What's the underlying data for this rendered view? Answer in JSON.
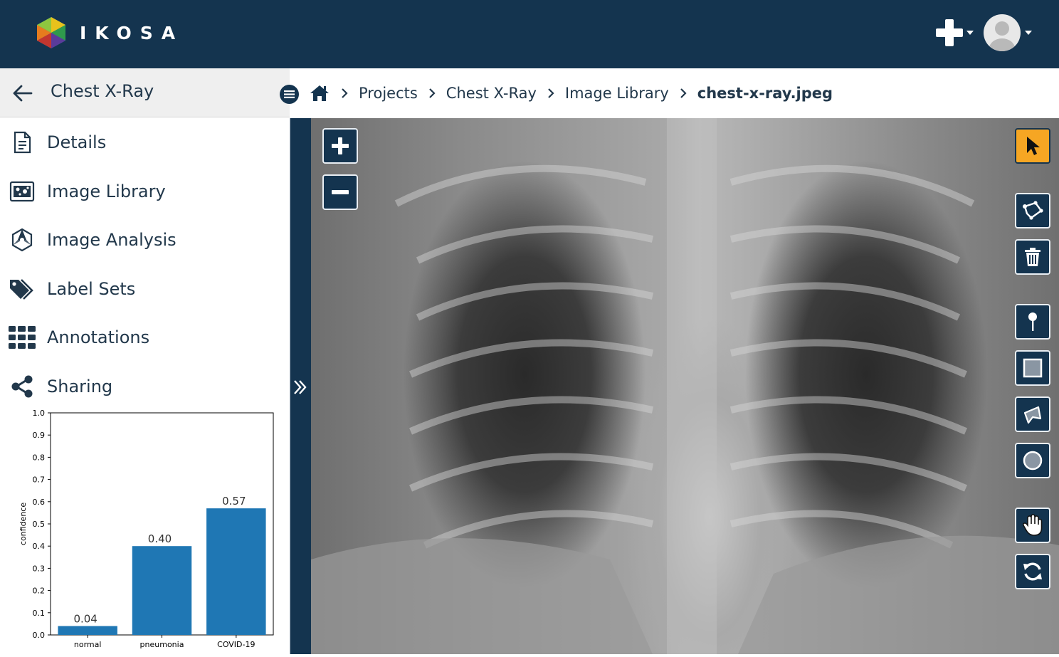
{
  "app": {
    "name": "IKOSA"
  },
  "topbar": {
    "add_icon": "plus-icon",
    "user_icon": "user-avatar-icon"
  },
  "sidebar": {
    "back_icon": "arrow-left-icon",
    "project_title": "Chest X-Ray",
    "items": [
      {
        "label": "Details",
        "icon": "document-icon"
      },
      {
        "label": "Image Library",
        "icon": "image-library-icon"
      },
      {
        "label": "Image Analysis",
        "icon": "analysis-icon"
      },
      {
        "label": "Label Sets",
        "icon": "tags-icon"
      },
      {
        "label": "Annotations",
        "icon": "grid-icon"
      },
      {
        "label": "Sharing",
        "icon": "share-icon"
      }
    ]
  },
  "breadcrumb": {
    "home_icon": "home-icon",
    "items": [
      "Projects",
      "Chest X-Ray",
      "Image Library"
    ],
    "current": "chest-x-ray.jpeg"
  },
  "viewer": {
    "zoom_in_icon": "plus-icon",
    "zoom_out_icon": "minus-icon",
    "tools": [
      {
        "name": "select",
        "icon": "pointer-icon",
        "active": true
      },
      {
        "name": "polygon",
        "icon": "polygon-icon"
      },
      {
        "name": "delete",
        "icon": "trash-icon"
      },
      {
        "name": "pin",
        "icon": "pin-icon"
      },
      {
        "name": "rectangle",
        "icon": "square-icon"
      },
      {
        "name": "freehand",
        "icon": "freehand-shape-icon"
      },
      {
        "name": "circle",
        "icon": "circle-icon"
      },
      {
        "name": "pan",
        "icon": "hand-icon"
      },
      {
        "name": "reset",
        "icon": "refresh-icon"
      }
    ]
  },
  "colors": {
    "brand": "#14344f",
    "accent": "#f6a623",
    "bar": "#1f77b4"
  },
  "chart_data": {
    "type": "bar",
    "categories": [
      "normal",
      "pneumonia",
      "COVID-19"
    ],
    "values": [
      0.04,
      0.4,
      0.57
    ],
    "value_labels": [
      "0.04",
      "0.40",
      "0.57"
    ],
    "ylabel": "confidence",
    "xlabel": "",
    "ylim": [
      0.0,
      1.0
    ],
    "yticks": [
      "0.0",
      "0.1",
      "0.2",
      "0.3",
      "0.4",
      "0.5",
      "0.6",
      "0.7",
      "0.8",
      "0.9",
      "1.0"
    ],
    "grid": false
  }
}
